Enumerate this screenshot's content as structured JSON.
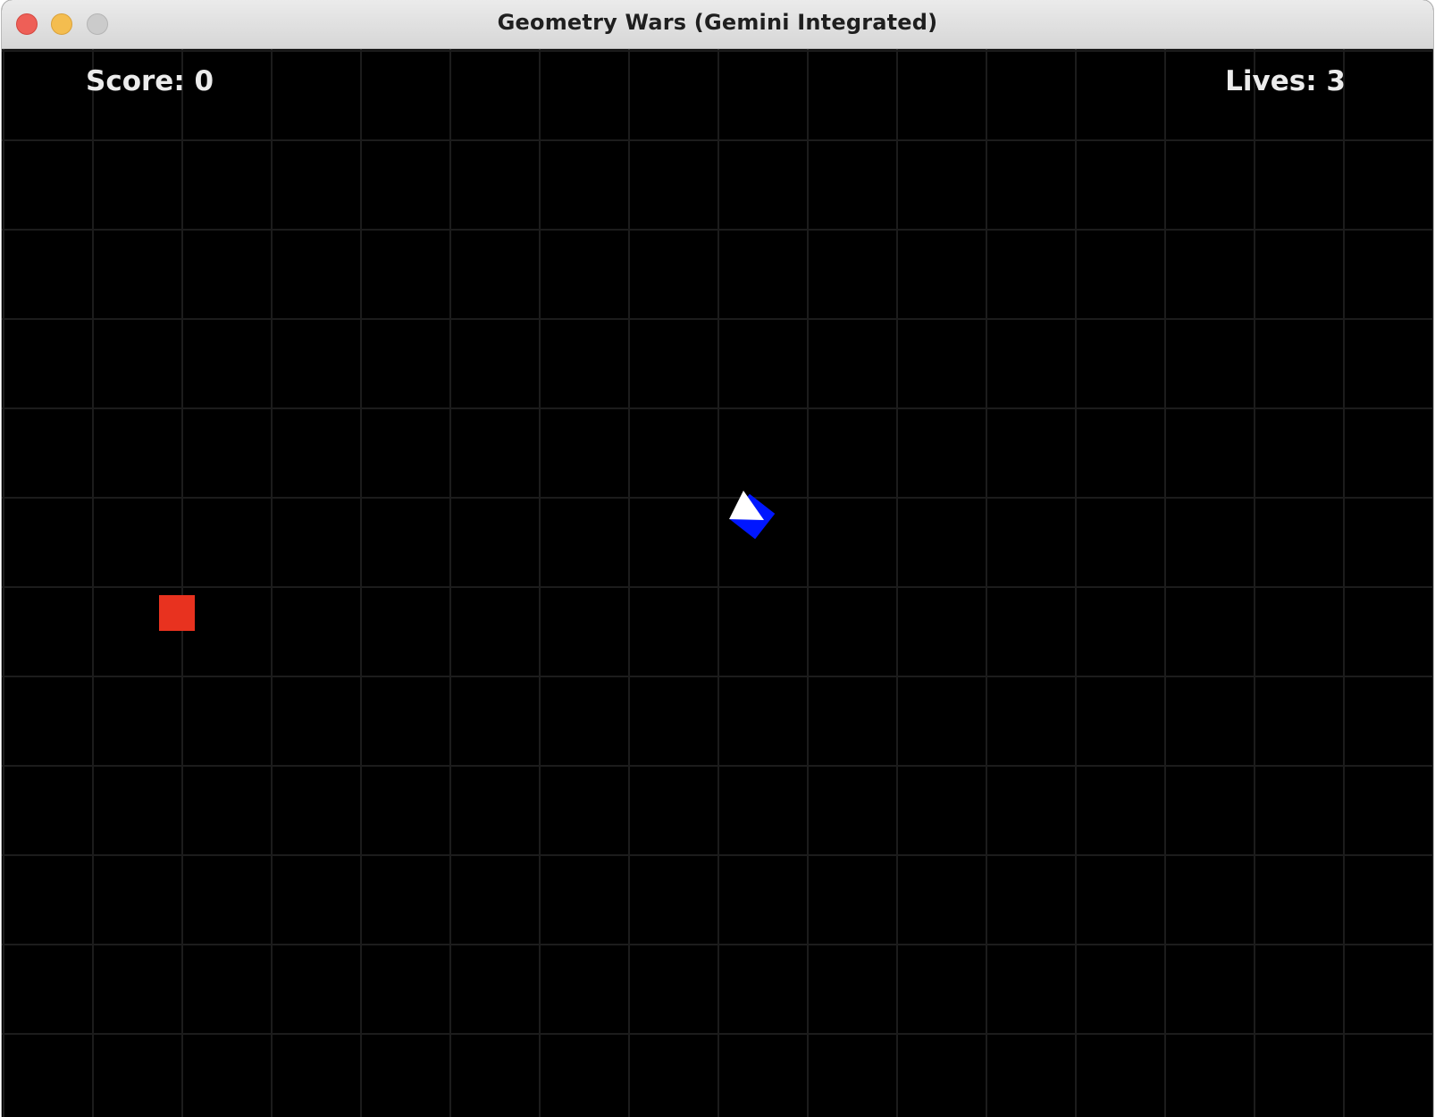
{
  "window": {
    "title": "Geometry Wars (Gemini Integrated)",
    "buttons": [
      "close",
      "minimize",
      "maximize"
    ]
  },
  "hud": {
    "score_text": "Score: 0",
    "lives_text": "Lives: 3"
  },
  "game": {
    "score": 0,
    "lives": 3,
    "player": {
      "shape": "triangle-ship",
      "colors": {
        "body": "#ffffff",
        "accent": "#0016ff"
      }
    },
    "enemies": [
      {
        "shape": "square",
        "color": "#e8321f"
      }
    ],
    "background": {
      "color": "#000000",
      "grid_color": "#1c1c1c",
      "grid": true
    }
  }
}
